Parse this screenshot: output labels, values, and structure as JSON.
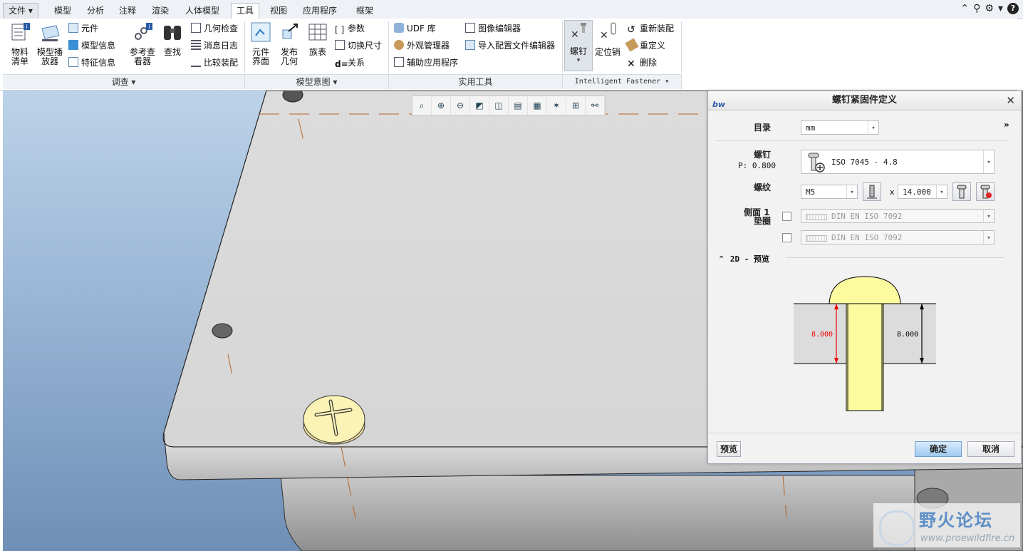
{
  "tabs": [
    "文件",
    "模型",
    "分析",
    "注释",
    "渲染",
    "人体模型",
    "工具",
    "视图",
    "应用程序",
    "框架"
  ],
  "active_tab": "工具",
  "ribbon": {
    "investigate": {
      "bom": "物料\n清单",
      "model_player": "模型播\n放器",
      "component": "元件",
      "model_info": "模型信息",
      "feature_info": "特征信息",
      "ref_viewer": "参考查\n看器",
      "find": "查找",
      "geom_check": "几何检查",
      "message_log": "消息日志",
      "compare_asm": "比较装配",
      "footer": "调查"
    },
    "model_intent": {
      "comp_interface": "元件\n界面",
      "publish_geom": "发布\n几何",
      "family_table": "族表",
      "params": "参数",
      "switch_dims": "切换尺寸",
      "relations": "关系",
      "footer": "模型意图"
    },
    "utilities": {
      "udf_lib": "UDF 库",
      "appearance_mgr": "外观管理器",
      "aux_app": "辅助应用程序",
      "image_editor": "图像编辑器",
      "import_config": "导入配置文件编辑器",
      "footer": "实用工具"
    },
    "fastener": {
      "screw": "螺钉",
      "dowel": "定位销",
      "reassemble": "重新装配",
      "redefine": "重定义",
      "delete": "删除",
      "footer": "Intelligent Fastener"
    }
  },
  "dialog": {
    "title": "螺钉紧固件定义",
    "logo": "bw",
    "catalog_label": "目录",
    "catalog_value": "mm",
    "screw_label": "螺钉",
    "pitch": "P: 0.800",
    "screw_value": "ISO 7045 - 4.8",
    "thread_label": "螺纹",
    "thread_value": "M5",
    "times": "x",
    "length_value": "14.000",
    "side1_label": "侧面 1",
    "washer_label": "垫圈",
    "washer1_value": "DIN EN ISO 7092",
    "washer2_value": "DIN EN ISO 7092",
    "preview_section": "2D - 预览",
    "dim_left": "8.000",
    "dim_right": "8.000",
    "preview_btn": "预览",
    "ok_btn": "确定",
    "cancel_btn": "取消",
    "expand": "»"
  },
  "watermark": {
    "title": "野火论坛",
    "url": "www.proewildfire.cn"
  }
}
